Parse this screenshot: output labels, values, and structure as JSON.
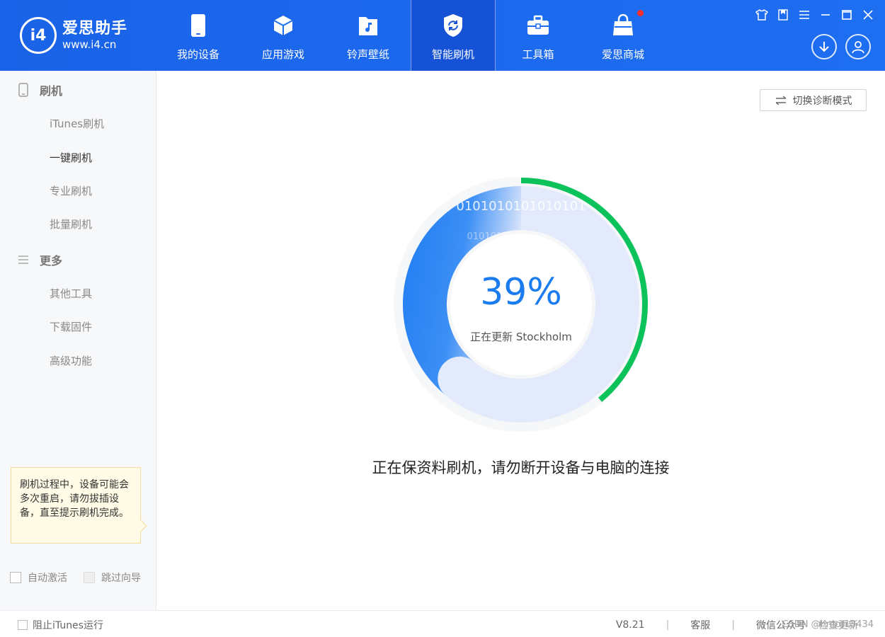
{
  "app": {
    "logo_mark": "i4",
    "logo_name": "爱思助手",
    "logo_url": "www.i4.cn"
  },
  "nav": [
    {
      "label": "我的设备",
      "icon": "phone-icon"
    },
    {
      "label": "应用游戏",
      "icon": "cube-icon"
    },
    {
      "label": "铃声壁纸",
      "icon": "music-folder-icon"
    },
    {
      "label": "智能刷机",
      "icon": "refresh-shield-icon",
      "active": true
    },
    {
      "label": "工具箱",
      "icon": "toolbox-icon"
    },
    {
      "label": "爱思商城",
      "icon": "shopping-bag-icon",
      "badge": true
    }
  ],
  "sidebar": {
    "section_flash": "刷机",
    "flash_items": [
      "iTunes刷机",
      "一键刷机",
      "专业刷机",
      "批量刷机"
    ],
    "active_item": "一键刷机",
    "section_more": "更多",
    "more_items": [
      "其他工具",
      "下载固件",
      "高级功能"
    ],
    "tip": "刷机过程中，设备可能会多次重启，请勿拔插设备，直至提示刷机完成。",
    "auto_activate": "自动激活",
    "skip_guide": "跳过向导"
  },
  "main": {
    "diag_button": "切换诊断模式",
    "progress_text": "39%",
    "progress_value": 0.39,
    "status": "正在更新 Stockholm",
    "binary_text": "0101010101010101",
    "binary_text2": "0101010101",
    "warning": "正在保资料刷机，请勿断开设备与电脑的连接"
  },
  "statusbar": {
    "block_itunes": "阻止iTunes运行",
    "version": "V8.21",
    "service": "客服",
    "wechat": "微信公众号",
    "update": "检查更新",
    "watermark": "CSDN @hmot13434"
  },
  "colors": {
    "topbar": "#1e6ef2",
    "accent": "#1b7cf0",
    "progress_green": "#0bc35a",
    "ring_light": "#e3eafb"
  }
}
